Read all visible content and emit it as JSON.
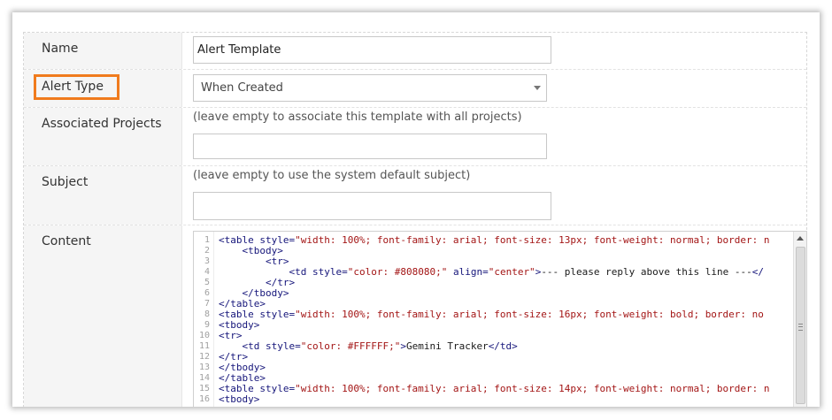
{
  "form": {
    "name": {
      "label": "Name",
      "value": "Alert Template"
    },
    "alert_type": {
      "label": "Alert Type",
      "selected": "When Created"
    },
    "associated_projects": {
      "label": "Associated Projects",
      "hint": "(leave empty to associate this template with all projects)",
      "value": ""
    },
    "subject": {
      "label": "Subject",
      "hint": "(leave empty to use the system default subject)",
      "value": ""
    },
    "content": {
      "label": "Content",
      "lines": [
        [
          {
            "t": "tag",
            "v": "<table "
          },
          {
            "t": "attr",
            "v": "style="
          },
          {
            "t": "str",
            "v": "\"width: 100%; font-family: arial; font-size: 13px; font-weight: normal; border: n"
          }
        ],
        [
          {
            "t": "text",
            "v": "    "
          },
          {
            "t": "tag",
            "v": "<tbody>"
          }
        ],
        [
          {
            "t": "text",
            "v": "        "
          },
          {
            "t": "tag",
            "v": "<tr>"
          }
        ],
        [
          {
            "t": "text",
            "v": "            "
          },
          {
            "t": "tag",
            "v": "<td "
          },
          {
            "t": "attr",
            "v": "style="
          },
          {
            "t": "str",
            "v": "\"color: #808080;\""
          },
          {
            "t": "text",
            "v": " "
          },
          {
            "t": "attr",
            "v": "align="
          },
          {
            "t": "str",
            "v": "\"center\""
          },
          {
            "t": "tag",
            "v": ">"
          },
          {
            "t": "text",
            "v": "--- please reply above this line ---"
          },
          {
            "t": "tag",
            "v": "</"
          }
        ],
        [
          {
            "t": "text",
            "v": "        "
          },
          {
            "t": "tag",
            "v": "</tr>"
          }
        ],
        [
          {
            "t": "text",
            "v": "    "
          },
          {
            "t": "tag",
            "v": "</tbody>"
          }
        ],
        [
          {
            "t": "tag",
            "v": "</table>"
          }
        ],
        [
          {
            "t": "tag",
            "v": "<table "
          },
          {
            "t": "attr",
            "v": "style="
          },
          {
            "t": "str",
            "v": "\"width: 100%; font-family: arial; font-size: 16px; font-weight: bold; border: no"
          }
        ],
        [
          {
            "t": "tag",
            "v": "<tbody>"
          }
        ],
        [
          {
            "t": "tag",
            "v": "<tr>"
          }
        ],
        [
          {
            "t": "text",
            "v": "    "
          },
          {
            "t": "tag",
            "v": "<td "
          },
          {
            "t": "attr",
            "v": "style="
          },
          {
            "t": "str",
            "v": "\"color: #FFFFFF;\""
          },
          {
            "t": "tag",
            "v": ">"
          },
          {
            "t": "text",
            "v": "Gemini Tracker"
          },
          {
            "t": "tag",
            "v": "</td>"
          }
        ],
        [
          {
            "t": "tag",
            "v": "</tr>"
          }
        ],
        [
          {
            "t": "tag",
            "v": "</tbody>"
          }
        ],
        [
          {
            "t": "tag",
            "v": "</table>"
          }
        ],
        [
          {
            "t": "tag",
            "v": "<table "
          },
          {
            "t": "attr",
            "v": "style="
          },
          {
            "t": "str",
            "v": "\"width: 100%; font-family: arial; font-size: 14px; font-weight: normal; border: n"
          }
        ],
        [
          {
            "t": "tag",
            "v": "<tbody>"
          }
        ]
      ]
    }
  },
  "icons": {
    "select_caret": "chevron-down-icon",
    "scroll_up": "arrow-up-icon",
    "scroll_grip": "grip-icon"
  },
  "colors": {
    "highlight": "#f07b1d"
  }
}
